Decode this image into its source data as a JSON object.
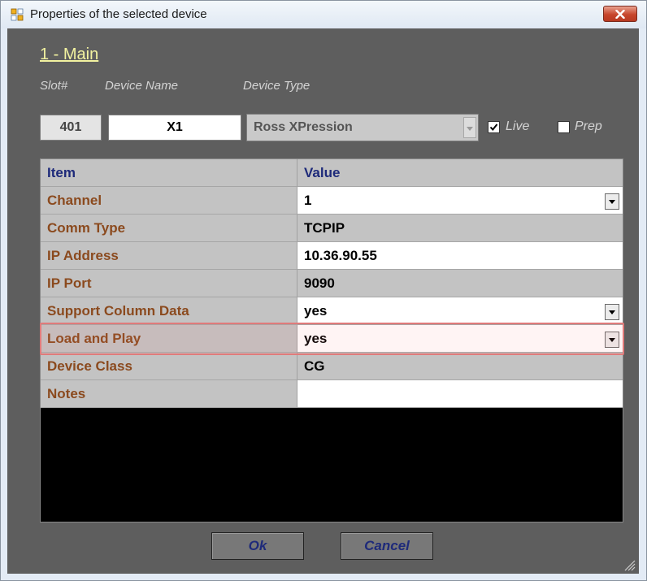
{
  "window": {
    "title": "Properties of the selected device"
  },
  "main": {
    "heading": "1 - Main",
    "labels": {
      "slot": "Slot#",
      "device_name": "Device Name",
      "device_type": "Device Type"
    },
    "slot_value": "401",
    "device_name_value": "X1",
    "device_type_value": "Ross XPression",
    "live": {
      "label": "Live",
      "checked": true
    },
    "prep": {
      "label": "Prep",
      "checked": false
    }
  },
  "grid": {
    "headers": [
      "Item",
      "Value"
    ],
    "rows": [
      {
        "item": "Channel",
        "value": "1"
      },
      {
        "item": "Comm Type",
        "value": "TCPIP"
      },
      {
        "item": "IP Address",
        "value": "10.36.90.55"
      },
      {
        "item": "IP Port",
        "value": "9090"
      },
      {
        "item": "Support Column Data",
        "value": "yes"
      },
      {
        "item": "Load and Play",
        "value": "yes"
      },
      {
        "item": "Device Class",
        "value": "CG"
      },
      {
        "item": "Notes",
        "value": ""
      }
    ]
  },
  "buttons": {
    "ok": "Ok",
    "cancel": "Cancel"
  }
}
